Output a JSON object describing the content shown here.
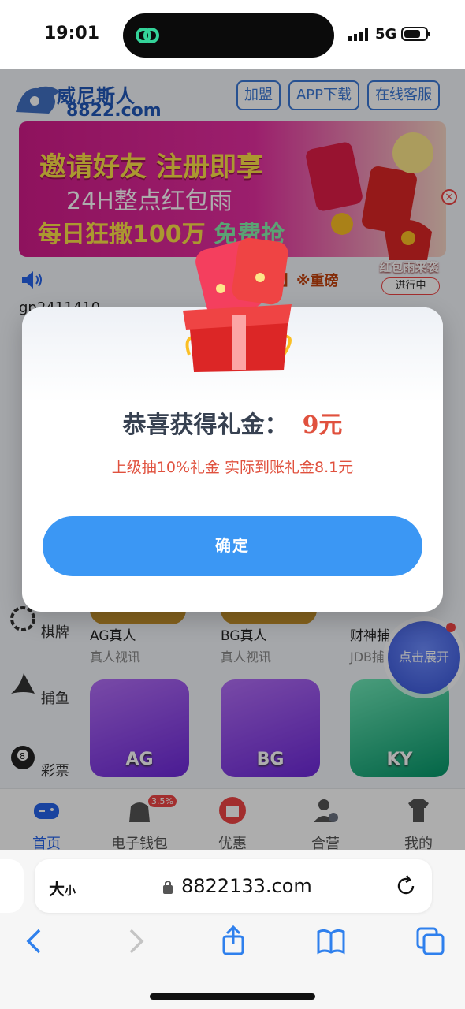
{
  "status_bar": {
    "time": "19:01",
    "network": "5G"
  },
  "site": {
    "brand": "威尼斯人",
    "domain": "8822.com",
    "header_buttons": [
      "加盟",
      "APP下载",
      "在线客服"
    ],
    "banner": {
      "line1": "邀请好友 注册即享",
      "line2": "24H整点红包雨",
      "line3a": "每日狂撒100万 ",
      "line3b": "免费抢"
    },
    "marquee": "荐】※重磅",
    "username": "gp2411410",
    "red_envelope_badge": {
      "title": "红包雨来袭",
      "status": "进行中"
    },
    "sidebar": [
      {
        "label": "棋牌",
        "icon": "cards-icon"
      },
      {
        "label": "捕鱼",
        "icon": "shark-icon"
      },
      {
        "label": "彩票",
        "icon": "billiard-8-icon"
      }
    ],
    "games_row1": [
      {
        "title": "AG真人",
        "sub": "真人视讯"
      },
      {
        "title": "BG真人",
        "sub": "真人视讯"
      },
      {
        "title": "财神捕",
        "sub": "JDB捕"
      }
    ],
    "games_row2": [
      {
        "label": "AG"
      },
      {
        "label": "BG"
      },
      {
        "label": "KY"
      }
    ],
    "float_button": "点击展开",
    "tabbar": [
      {
        "label": "首页",
        "icon": "gamepad-icon",
        "active": true
      },
      {
        "label": "电子钱包",
        "icon": "wallet-icon",
        "badge": "3.5%"
      },
      {
        "label": "优惠",
        "icon": "gift-icon"
      },
      {
        "label": "合营",
        "icon": "user-check-icon"
      },
      {
        "label": "我的",
        "icon": "shirt-icon"
      }
    ]
  },
  "modal": {
    "title": "恭喜获得礼金：",
    "amount": "9元",
    "note": "上级抽10%礼金 实际到账礼金8.1元",
    "confirm": "确定"
  },
  "browser": {
    "text_size": "大",
    "text_size_small": "小",
    "url": "8822133.com"
  },
  "colors": {
    "accent": "#3b97f4",
    "amount": "#e0513e",
    "brand": "#2158b8"
  }
}
